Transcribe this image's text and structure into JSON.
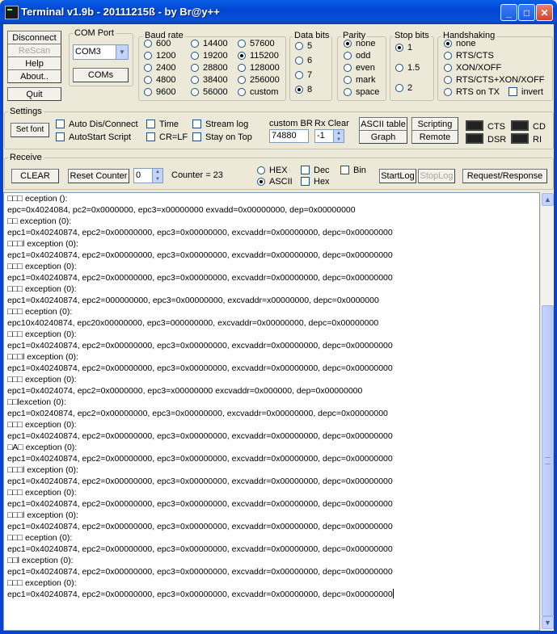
{
  "window": {
    "title": "Terminal v1.9b - 20111215ß - by Br@y++"
  },
  "left_buttons": {
    "disconnect": "Disconnect",
    "rescan": "ReScan",
    "help": "Help",
    "about": "About..",
    "quit": "Quit"
  },
  "com_port": {
    "label": "COM Port",
    "selected": "COM3",
    "coms_button": "COMs"
  },
  "baud_rate": {
    "label": "Baud rate",
    "options": [
      "600",
      "1200",
      "2400",
      "4800",
      "9600",
      "14400",
      "19200",
      "28800",
      "38400",
      "56000",
      "57600",
      "115200",
      "128000",
      "256000",
      "custom"
    ],
    "selected": "115200"
  },
  "data_bits": {
    "label": "Data bits",
    "options": [
      "5",
      "6",
      "7",
      "8"
    ],
    "selected": "8"
  },
  "parity": {
    "label": "Parity",
    "options": [
      "none",
      "odd",
      "even",
      "mark",
      "space"
    ],
    "selected": "none"
  },
  "stop_bits": {
    "label": "Stop bits",
    "options": [
      "1",
      "1.5",
      "2"
    ],
    "selected": "1"
  },
  "handshaking": {
    "label": "Handshaking",
    "options": [
      "none",
      "RTS/CTS",
      "XON/XOFF",
      "RTS/CTS+XON/XOFF",
      "RTS on TX"
    ],
    "selected": "none",
    "invert_label": "invert"
  },
  "settings": {
    "label": "Settings",
    "set_font": "Set font",
    "auto_dis_connect": "Auto Dis/Connect",
    "autostart_script": "AutoStart Script",
    "time": "Time",
    "cr_lf": "CR=LF",
    "stream_log": "Stream log",
    "stay_on_top": "Stay on Top",
    "custom_br_label": "custom BR",
    "custom_br_value": "74880",
    "rx_clear_label": "Rx Clear",
    "rx_clear_value": "-1",
    "ascii_table": "ASCII table",
    "graph": "Graph",
    "scripting": "Scripting",
    "remote": "Remote",
    "leds": [
      "CTS",
      "CD",
      "DSR",
      "RI"
    ]
  },
  "receive": {
    "label": "Receive",
    "clear": "CLEAR",
    "reset_counter": "Reset Counter",
    "counter_spin_value": "0",
    "counter_label": "Counter = ",
    "counter_value": "23",
    "hex": "HEX",
    "ascii": "ASCII",
    "mode_selected": "ASCII",
    "dec": "Dec",
    "hex_check": "Hex",
    "bin": "Bin",
    "start_log": "StartLog",
    "stop_log": "StopLog",
    "request_response": "Request/Response"
  },
  "terminal_lines": [
    "□□□ eception ():",
    "epc=0x4024084, pc2=0x0000000, epc3=x00000000 exvadd=0x00000000, dep=0x00000000",
    "□□ exception (0):",
    "epc1=0x40240874, epc2=0x00000000, epc3=0x00000000, excvaddr=0x00000000, depc=0x00000000",
    "□□□l exception (0):",
    "epc1=0x40240874, epc2=0x00000000, epc3=0x00000000, excvaddr=0x00000000, depc=0x00000000",
    "□□□ exception (0):",
    "epc1=0x40240874, epc2=0x00000000, epc3=0x00000000, excvaddr=0x00000000, depc=0x00000000",
    "□□□ exception (0):",
    "epc1=0x40240874, epc2=000000000, epc3=0x00000000, excvaddr=x00000000, depc=0x0000000",
    "□□□ eception (0):",
    "epc10x40240874, epc20x00000000, epc3=000000000, excvaddr=0x00000000, depc=0x00000000",
    "□□□ exception (0):",
    "epc1=0x40240874, epc2=0x00000000, epc3=0x00000000, excvaddr=0x00000000, depc=0x00000000",
    "□□□l exception (0):",
    "epc1=0x40240874, epc2=0x00000000, epc3=0x00000000, excvaddr=0x00000000, depc=0x00000000",
    "□□□ exception (0):",
    "epc1=0x4024074, epc2=0x0000000, epc3=x00000000 excvaddr=0x000000, dep=0x00000000",
    "□□lexcetion (0):",
    "epc1=0x0240874, epc2=0x00000000, epc3=0x00000000, excvaddr=0x00000000, depc=0x00000000",
    "□□□ exception (0):",
    "epc1=0x40240874, epc2=0x00000000, epc3=0x00000000, excvaddr=0x00000000, depc=0x00000000",
    "□A□ exception (0):",
    "epc1=0x40240874, epc2=0x00000000, epc3=0x00000000, excvaddr=0x00000000, depc=0x00000000",
    "□□□l exception (0):",
    "epc1=0x40240874, epc2=0x00000000, epc3=0x00000000, excvaddr=0x00000000, depc=0x00000000",
    "□□□ exception (0):",
    "epc1=0x40240874, epc2=0x00000000, epc3=0x00000000, excvaddr=0x00000000, depc=0x00000000",
    "□□□l exception (0):",
    "epc1=0x40240874, epc2=0x00000000, epc3=0x00000000, excvaddr=0x00000000, depc=0x00000000",
    "□□□ eception (0):",
    "epc1=0x40240874, epc2=0x00000000, epc3=0x00000000, excvaddr=0x00000000, depc=0x00000000",
    "□□l exception (0):",
    "epc1=0x40240874, epc2=0x00000000, epc3=0x00000000, excvaddr=0x00000000, depc=0x00000000",
    "□□□ exception (0):",
    "epc1=0x40240874, epc2=0x00000000, epc3=0x00000000, excvaddr=0x00000000, depc=0x00000000"
  ]
}
